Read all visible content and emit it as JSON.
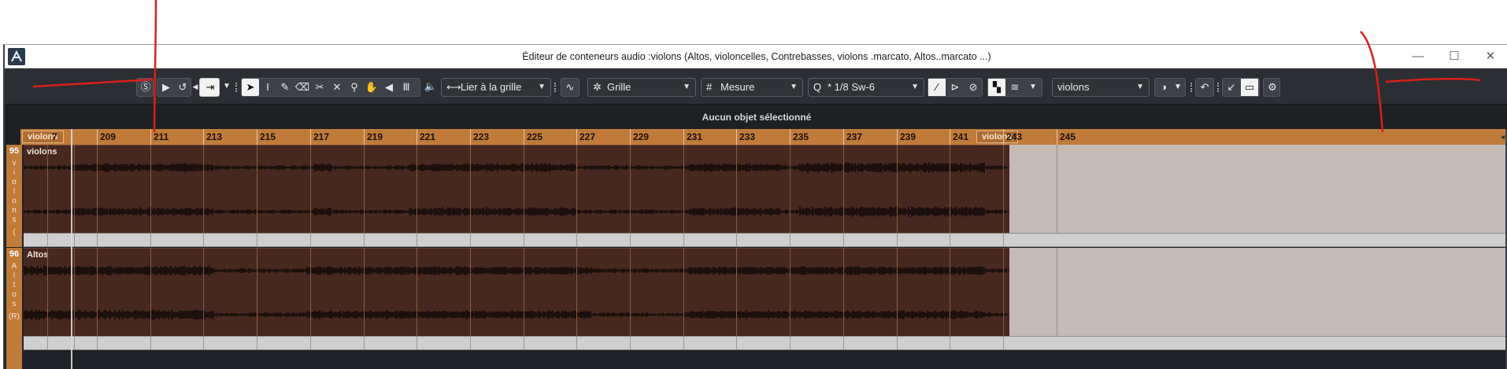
{
  "window": {
    "title": "Éditeur de conteneurs audio :violons  (Altos, violoncelles, Contrebasses, violons .marcato, Altos..marcato ...)",
    "minimize": "—",
    "maximize": "☐",
    "close": "✕"
  },
  "toolbar": {
    "snap_mode": "Lier à la grille",
    "grid_type": "Grille",
    "grid_unit": "Mesure",
    "quantize": "* 1/8  Sw-6",
    "track_selector": "violons",
    "icons": [
      "solo-icon",
      "play-icon",
      "loop-icon",
      "auto-scroll-icon",
      "object-select-icon",
      "range-icon",
      "draw-icon",
      "erase-icon",
      "split-icon",
      "mute-icon",
      "zoom-icon",
      "hand-icon",
      "comp-icon",
      "timewarp-icon",
      "speaker-icon",
      "snap-icon",
      "settings-icon"
    ]
  },
  "info_line": {
    "text": "Aucun objet sélectionné"
  },
  "ruler": {
    "left_locator": "violons",
    "right_locator": "violons",
    "partial_label": "7",
    "bars": [
      "209",
      "211",
      "213",
      "215",
      "217",
      "219",
      "221",
      "223",
      "225",
      "227",
      "229",
      "231",
      "233",
      "235",
      "237",
      "239",
      "241",
      "243",
      "245"
    ]
  },
  "tracks": [
    {
      "number": "95",
      "name": "violons",
      "vertical": "violons",
      "suffix": "("
    },
    {
      "number": "96",
      "name": "Altos",
      "vertical": "Altos",
      "suffix": "(R)"
    }
  ],
  "colors": {
    "ruler": "#c07a3a",
    "region": "#472820",
    "annotation": "#d8201a"
  }
}
